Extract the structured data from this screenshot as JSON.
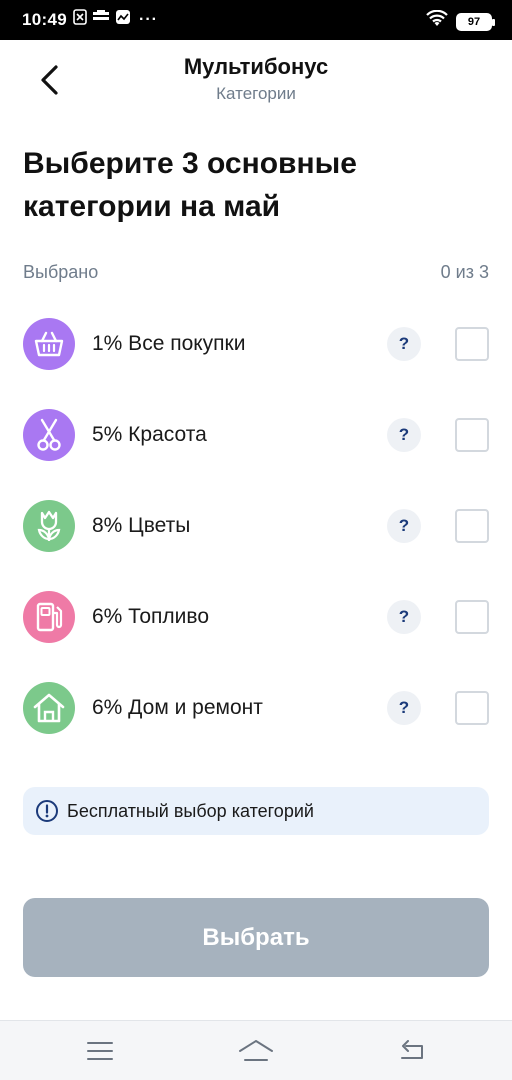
{
  "status_bar": {
    "time": "10:49",
    "battery": "97",
    "more": "···",
    "icons": [
      "close-box-icon",
      "list-icon",
      "message-icon",
      "wifi-icon",
      "battery-icon"
    ]
  },
  "header": {
    "title": "Мультибонус",
    "subtitle": "Категории",
    "back_icon": "chevron-left-icon"
  },
  "heading": "Выберите 3 основные категории на май",
  "selection": {
    "label": "Выбрано",
    "count": "0 из 3"
  },
  "categories": [
    {
      "label": "1% Все покупки",
      "icon": "basket-icon",
      "color": "#a978f2",
      "checked": false,
      "help": "?"
    },
    {
      "label": "5% Красота",
      "icon": "scissors-icon",
      "color": "#a978f2",
      "checked": false,
      "help": "?"
    },
    {
      "label": "8% Цветы",
      "icon": "flower-icon",
      "color": "#7cc98b",
      "checked": false,
      "help": "?"
    },
    {
      "label": "6% Топливо",
      "icon": "fuel-icon",
      "color": "#ef7aa6",
      "checked": false,
      "help": "?"
    },
    {
      "label": "6% Дом и ремонт",
      "icon": "house-icon",
      "color": "#7cc98b",
      "checked": false,
      "help": "?"
    }
  ],
  "info_banner": {
    "icon": "info-icon",
    "text": "Бесплатный выбор категорий"
  },
  "primary_button": {
    "label": "Выбрать",
    "disabled": true
  },
  "nav_bar": {
    "icons": [
      "menu-icon",
      "home-icon",
      "back-icon"
    ]
  },
  "colors": {
    "accent_dark": "#1b3a7a",
    "muted_text": "#6f7c8b",
    "button_disabled": "#a6b2be",
    "banner_bg": "#e9f1fb"
  }
}
